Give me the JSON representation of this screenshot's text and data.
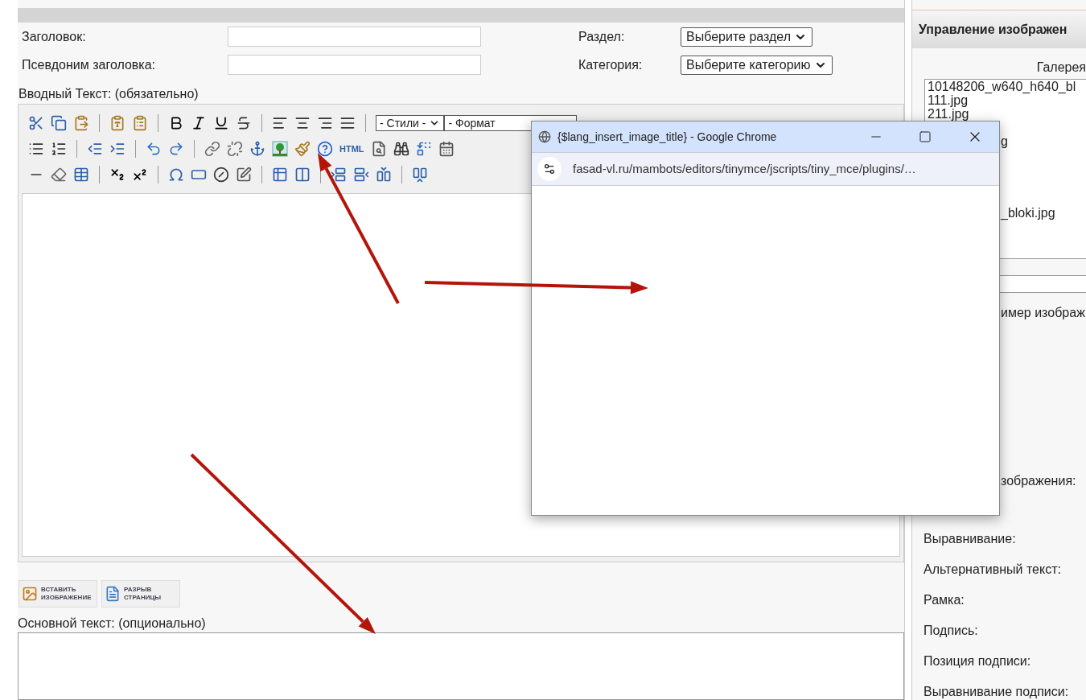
{
  "fields": [
    {
      "label": "Заголовок:",
      "kind": "input"
    },
    {
      "label": "Псевдоним заголовка:",
      "kind": "input"
    }
  ],
  "selects": [
    {
      "label": "Раздел:",
      "value": "Выберите раздел"
    },
    {
      "label": "Категория:",
      "value": "Выберите категорию"
    }
  ],
  "intro_label": "Вводный Текст: (обязательно)",
  "toolbar": {
    "styles_select": "- Стили -",
    "format_select": "- Формат",
    "html_button": "HTML"
  },
  "editor_buttons": [
    {
      "label": "ВСТАВИТЬ ИЗОБРАЖЕНИЕ",
      "kind": "image"
    },
    {
      "label": "РАЗРЫВ СТРАНИЦЫ",
      "kind": "pagebreak"
    }
  ],
  "main_label": "Основной текст: (опционально)",
  "image_panel": {
    "title": "Управление изображен",
    "gallery_label": "Галерея",
    "files": [
      {
        "text": "10148206_w640_h640_bl",
        "kind": "full"
      },
      {
        "text": "111.jpg",
        "kind": "full"
      },
      {
        "text": "211.jpg",
        "kind": "full"
      },
      {
        "text": "g",
        "kind": "fragment"
      },
      {
        "text": "_bloki.jpg",
        "kind": "fragment_after_gap"
      }
    ],
    "preview_label": "имер изображ",
    "size_label": "зображения:",
    "labels": [
      "Выравнивание:",
      "Альтернативный текст:",
      "Рамка:",
      "Подпись:",
      "Позиция подписи:",
      "Выравнивание подписи:"
    ]
  },
  "popup": {
    "title": "{$lang_insert_image_title} - Google Chrome",
    "url": "fasad-vl.ru/mambots/editors/tinymce/jscripts/tiny_mce/plugins/…"
  }
}
